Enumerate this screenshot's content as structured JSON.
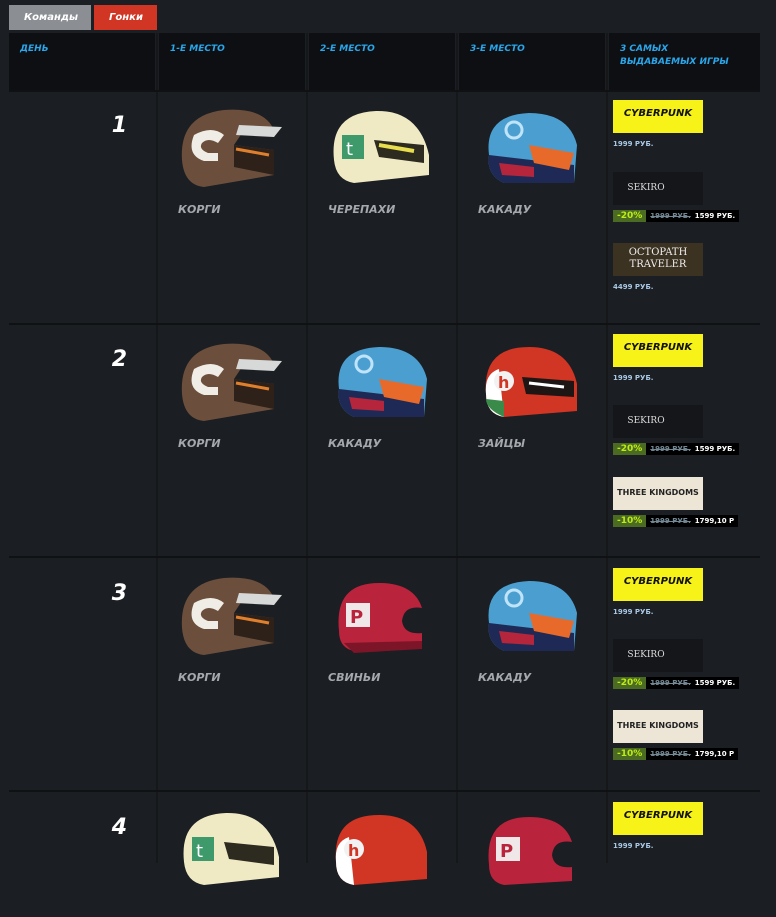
{
  "tabs": {
    "teams": "Команды",
    "races": "Гонки"
  },
  "header": {
    "day": "ДЕНЬ",
    "first": "1-Е МЕСТО",
    "second": "2-Е МЕСТО",
    "third": "3-Е МЕСТО",
    "games": "3 САМЫХ ВЫДАВАЕМЫХ ИГРЫ"
  },
  "days": [
    {
      "day": "1",
      "places": [
        "КОРГИ",
        "ЧЕРЕПАХИ",
        "КАКАДУ"
      ],
      "games": [
        {
          "logo": "CYBERPUNK",
          "price": "1999 РУБ."
        },
        {
          "logo": "SEKIRO",
          "discount": "-20%",
          "old": "1999 РУБ.",
          "new": "1599 РУБ."
        },
        {
          "logo": "OCTOPATH TRAVELER",
          "price": "4499 РУБ."
        }
      ]
    },
    {
      "day": "2",
      "places": [
        "КОРГИ",
        "КАКАДУ",
        "ЗАЙЦЫ"
      ],
      "games": [
        {
          "logo": "CYBERPUNK",
          "price": "1999 РУБ."
        },
        {
          "logo": "SEKIRO",
          "discount": "-20%",
          "old": "1999 РУБ.",
          "new": "1599 РУБ."
        },
        {
          "logo": "THREE KINGDOMS",
          "discount": "-10%",
          "old": "1999 РУБ.",
          "new": "1799,10 Р"
        }
      ]
    },
    {
      "day": "3",
      "places": [
        "КОРГИ",
        "СВИНЬИ",
        "КАКАДУ"
      ],
      "games": [
        {
          "logo": "CYBERPUNK",
          "price": "1999 РУБ."
        },
        {
          "logo": "SEKIRO",
          "discount": "-20%",
          "old": "1999 РУБ.",
          "new": "1599 РУБ."
        },
        {
          "logo": "THREE KINGDOMS",
          "discount": "-10%",
          "old": "1999 РУБ.",
          "new": "1799,10 Р"
        }
      ]
    },
    {
      "day": "4",
      "games": [
        {
          "logo": "CYBERPUNK",
          "price": "1999 РУБ."
        }
      ]
    }
  ]
}
